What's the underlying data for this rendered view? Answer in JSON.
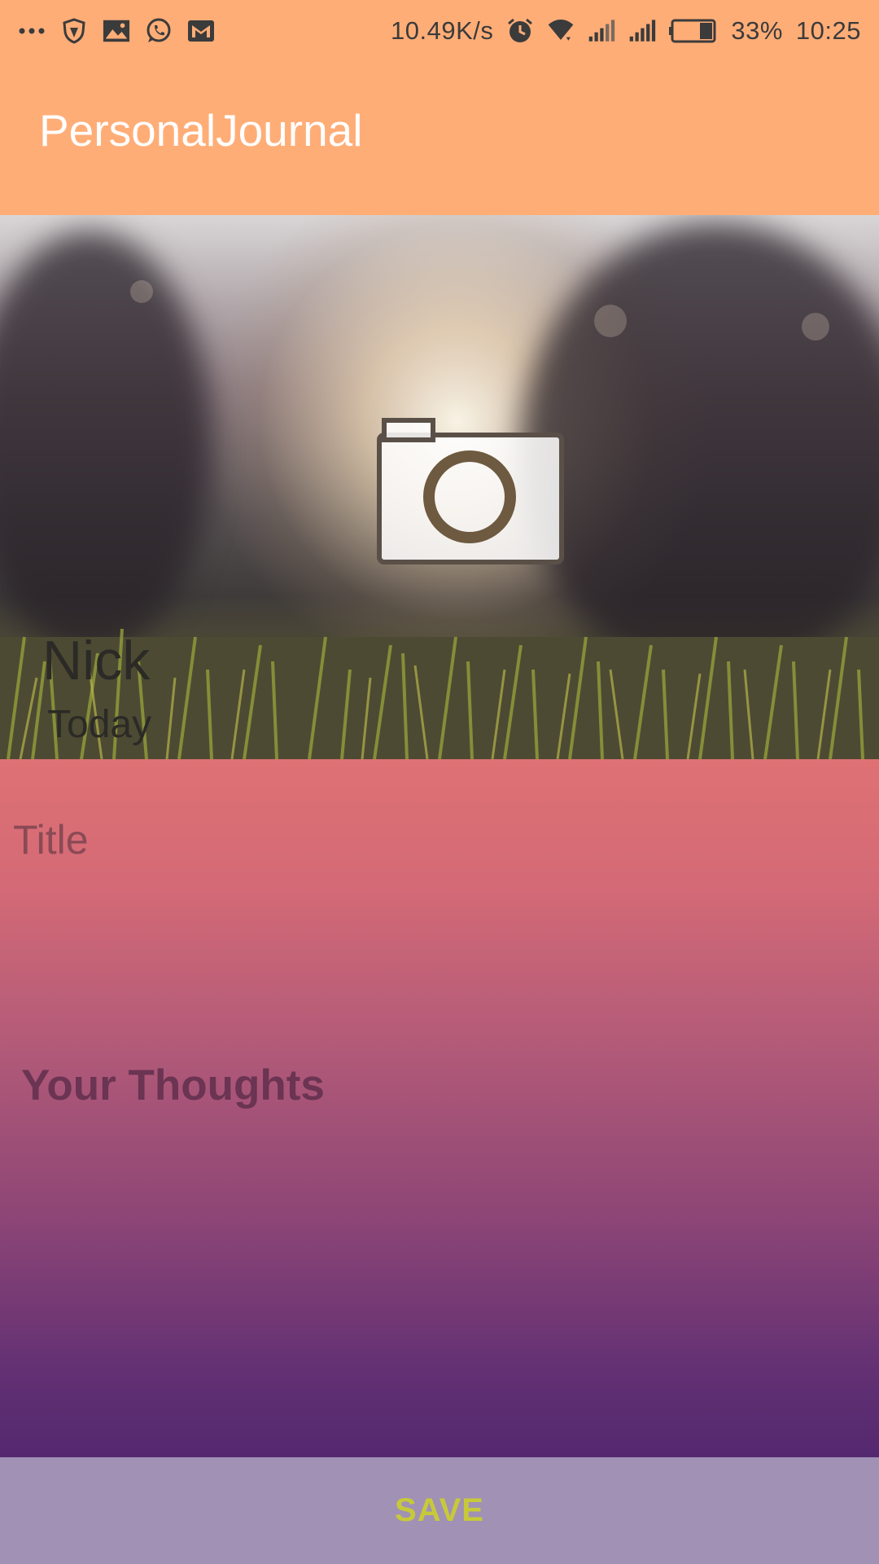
{
  "status_bar": {
    "network_speed": "10.49K/s",
    "battery_percent": "33%",
    "time": "10:25",
    "battery_level": 0.33,
    "left_icons": [
      "more-dots-icon",
      "shield-icon",
      "gallery-icon",
      "whatsapp-icon",
      "gmail-icon"
    ],
    "right_icons": [
      "alarm-icon",
      "wifi-icon",
      "signal-icon",
      "signal-icon",
      "battery-icon"
    ]
  },
  "toolbar": {
    "title": "PersonalJournal",
    "background": "#FFAD77"
  },
  "hero": {
    "author": "Nick",
    "date": "Today",
    "camera_icon": "camera-icon"
  },
  "entry": {
    "title_placeholder": "Title",
    "thoughts_placeholder": "Your Thoughts",
    "gradient_top": "#DE7174",
    "gradient_bottom": "#54286F"
  },
  "actions": {
    "save_label": "SAVE",
    "save_color": "#C7C93A",
    "bar_color": "#A091B5"
  }
}
